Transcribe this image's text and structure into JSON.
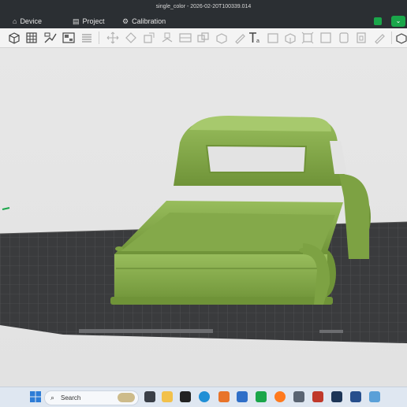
{
  "window": {
    "title": "single_color - 2026-02-20T100339.014"
  },
  "menu": {
    "device_label": "Device",
    "project_label": "Project",
    "calibration_label": "Calibration"
  },
  "taskbar": {
    "search_placeholder": "Search"
  },
  "colors": {
    "title_bar": "#2b2f33",
    "toolbar_bg": "#f4f4f4",
    "viewport_bg": "#e4e4e4",
    "model_green": "#82a84a",
    "plate": "#3a3b3d",
    "accent_green": "#1aa64a"
  },
  "icons": [
    "windows-start-icon",
    "search-icon",
    "file-explorer-icon",
    "edge-icon",
    "firefox-icon",
    "calculator-icon"
  ]
}
